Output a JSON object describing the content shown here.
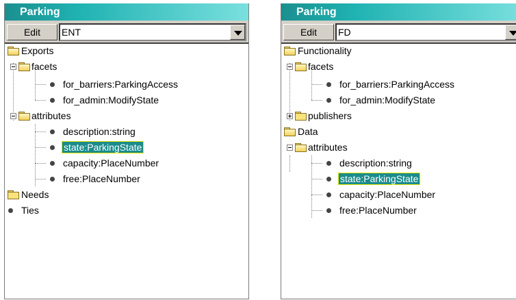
{
  "left_panel": {
    "title": "Parking",
    "edit_label": "Edit",
    "combo_value": "ENT",
    "tree": {
      "exports": "Exports",
      "facets": "facets",
      "facet_items": [
        "for_barriers:ParkingAccess",
        "for_admin:ModifyState"
      ],
      "attributes": "attributes",
      "attribute_items": [
        "description:string",
        "state:ParkingState",
        "capacity:PlaceNumber",
        "free:PlaceNumber"
      ],
      "needs": "Needs",
      "ties": "Ties"
    }
  },
  "right_panel": {
    "title": "Parking",
    "edit_label": "Edit",
    "combo_value": "FD",
    "tree": {
      "functionality": "Functionality",
      "facets": "facets",
      "facet_items": [
        "for_barriers:ParkingAccess",
        "for_admin:ModifyState"
      ],
      "publishers": "publishers",
      "data": "Data",
      "attributes": "attributes",
      "attribute_items": [
        "description:string",
        "state:ParkingState",
        "capacity:PlaceNumber",
        "free:PlaceNumber"
      ]
    }
  },
  "selected_item": "state:ParkingState",
  "colors": {
    "title_start": "#1b8f8f",
    "title_end": "#7ae0de",
    "selection_bg": "#1a8c8c",
    "selection_border": "#e6e600"
  }
}
